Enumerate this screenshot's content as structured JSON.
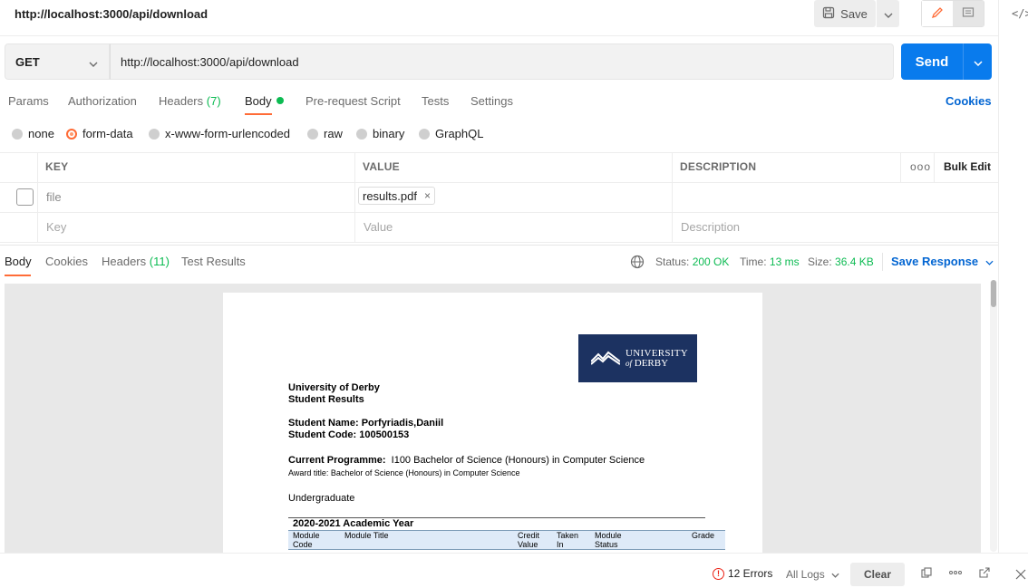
{
  "window": {
    "title_url": "http://localhost:3000/api/download"
  },
  "toolbar": {
    "save_label": "Save",
    "save_icon": "save-icon",
    "code_icon": "</>"
  },
  "request": {
    "method": "GET",
    "url": "http://localhost:3000/api/download",
    "send_label": "Send"
  },
  "req_tabs": {
    "params": "Params",
    "authorization": "Authorization",
    "headers": "Headers",
    "headers_count": "(7)",
    "body": "Body",
    "prerequest": "Pre-request Script",
    "tests": "Tests",
    "settings": "Settings",
    "cookies": "Cookies"
  },
  "body_types": {
    "none": "none",
    "form_data": "form-data",
    "urlencoded": "x-www-form-urlencoded",
    "raw": "raw",
    "binary": "binary",
    "graphql": "GraphQL",
    "selected": "form-data"
  },
  "params_table": {
    "headers": {
      "key": "KEY",
      "value": "VALUE",
      "description": "DESCRIPTION",
      "more": "ooo",
      "bulk_edit": "Bulk Edit"
    },
    "row1": {
      "key": "file",
      "value_file": "results.pdf",
      "remove": "×"
    },
    "new_row": {
      "key_placeholder": "Key",
      "value_placeholder": "Value",
      "description_placeholder": "Description"
    }
  },
  "response": {
    "tabs": {
      "body": "Body",
      "cookies": "Cookies",
      "headers": "Headers",
      "headers_count": "(11)",
      "test_results": "Test Results"
    },
    "status_label": "Status:",
    "status_value": "200 OK",
    "time_label": "Time:",
    "time_value": "13 ms",
    "size_label": "Size:",
    "size_value": "36.4 KB",
    "save_response": "Save Response"
  },
  "pdf": {
    "logo_line1": "UNIVERSITY",
    "logo_line2_of": "of",
    "logo_line2": "DERBY",
    "org": "University of Derby",
    "doc_title": "Student Results",
    "student_name_label": "Student Name:",
    "student_name": "Porfyriadis,Daniil",
    "student_code_label": "Student Code:",
    "student_code": "100500153",
    "programme_label": "Current Programme:",
    "programme": "I100 Bachelor of Science (Honours) in Computer Science",
    "award_label": "Award title:",
    "award": "Bachelor of Science (Honours) in Computer Science",
    "level": "Undergraduate",
    "year_title": "2020-2021 Academic Year",
    "columns": {
      "module_code_1": "Module",
      "module_code_2": "Code",
      "module_title": "Module Title",
      "credit_1": "Credit",
      "credit_2": "Value",
      "taken_1": "Taken",
      "taken_2": "In",
      "status_1": "Module",
      "status_2": "Status",
      "grade": "Grade"
    }
  },
  "statusbar": {
    "errors": "12 Errors",
    "logs": "All Logs",
    "clear": "Clear"
  },
  "colors": {
    "accent_orange": "#ff6c37",
    "send_blue": "#097bed",
    "link_blue": "#0265d2",
    "success_green": "#0cbb52",
    "error_red": "#eb2013",
    "derby_navy": "#1c3261"
  }
}
